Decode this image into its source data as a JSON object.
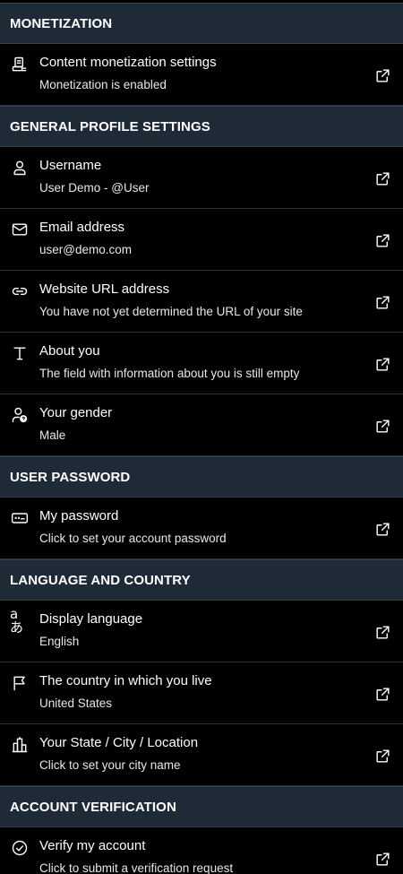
{
  "sections": [
    {
      "title": "MONETIZATION",
      "items": [
        {
          "title": "Content monetization settings",
          "subtitle": "Monetization is enabled",
          "icon": "monetization-icon"
        }
      ]
    },
    {
      "title": "GENERAL PROFILE SETTINGS",
      "items": [
        {
          "title": "Username",
          "subtitle": "User Demo - @User",
          "icon": "user-icon"
        },
        {
          "title": "Email address",
          "subtitle": "user@demo.com",
          "icon": "mail-icon"
        },
        {
          "title": "Website URL address",
          "subtitle": "You have not yet determined the URL of your site",
          "icon": "link-icon"
        },
        {
          "title": "About you",
          "subtitle": "The field with information about you is still empty",
          "icon": "text-icon"
        },
        {
          "title": "Your gender",
          "subtitle": "Male",
          "icon": "gender-icon"
        }
      ]
    },
    {
      "title": "USER PASSWORD",
      "items": [
        {
          "title": "My password",
          "subtitle": "Click to set your account password",
          "icon": "password-icon"
        }
      ]
    },
    {
      "title": "LANGUAGE AND COUNTRY",
      "items": [
        {
          "title": "Display language",
          "subtitle": "English",
          "icon": "language-icon",
          "glyph": "aあ"
        },
        {
          "title": "The country in which you live",
          "subtitle": "United States",
          "icon": "flag-icon"
        },
        {
          "title": "Your State / City / Location",
          "subtitle": "Click to set your city name",
          "icon": "building-icon"
        }
      ]
    },
    {
      "title": "ACCOUNT VERIFICATION",
      "items": [
        {
          "title": "Verify my account",
          "subtitle": "Click to submit a verification request",
          "icon": "verify-icon"
        }
      ]
    }
  ],
  "action_icon": "external-link-icon",
  "colors": {
    "background": "#000000",
    "header": "#1e2b37",
    "divider": "#2a333c",
    "text": "#ffffff"
  }
}
